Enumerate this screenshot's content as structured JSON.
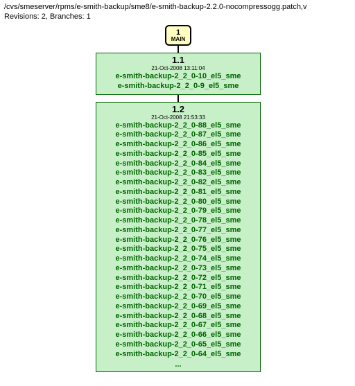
{
  "header": {
    "path": "/cvs/smeserver/rpms/e-smith-backup/sme8/e-smith-backup-2.2.0-nocompressogg.patch,v",
    "revinfo": "Revisions: 2, Branches: 1"
  },
  "branch": {
    "num": "1",
    "name": "MAIN"
  },
  "rev1": {
    "title": "1.1",
    "date": "21-Oct-2008 13:11:04",
    "lines": [
      "e-smith-backup-2_2_0-10_el5_sme",
      "e-smith-backup-2_2_0-9_el5_sme"
    ]
  },
  "rev2": {
    "title": "1.2",
    "date": "21-Oct-2008 21:53:33",
    "lines": [
      "e-smith-backup-2_2_0-88_el5_sme",
      "e-smith-backup-2_2_0-87_el5_sme",
      "e-smith-backup-2_2_0-86_el5_sme",
      "e-smith-backup-2_2_0-85_el5_sme",
      "e-smith-backup-2_2_0-84_el5_sme",
      "e-smith-backup-2_2_0-83_el5_sme",
      "e-smith-backup-2_2_0-82_el5_sme",
      "e-smith-backup-2_2_0-81_el5_sme",
      "e-smith-backup-2_2_0-80_el5_sme",
      "e-smith-backup-2_2_0-79_el5_sme",
      "e-smith-backup-2_2_0-78_el5_sme",
      "e-smith-backup-2_2_0-77_el5_sme",
      "e-smith-backup-2_2_0-76_el5_sme",
      "e-smith-backup-2_2_0-75_el5_sme",
      "e-smith-backup-2_2_0-74_el5_sme",
      "e-smith-backup-2_2_0-73_el5_sme",
      "e-smith-backup-2_2_0-72_el5_sme",
      "e-smith-backup-2_2_0-71_el5_sme",
      "e-smith-backup-2_2_0-70_el5_sme",
      "e-smith-backup-2_2_0-69_el5_sme",
      "e-smith-backup-2_2_0-68_el5_sme",
      "e-smith-backup-2_2_0-67_el5_sme",
      "e-smith-backup-2_2_0-66_el5_sme",
      "e-smith-backup-2_2_0-65_el5_sme",
      "e-smith-backup-2_2_0-64_el5_sme"
    ],
    "ellipsis": "..."
  }
}
